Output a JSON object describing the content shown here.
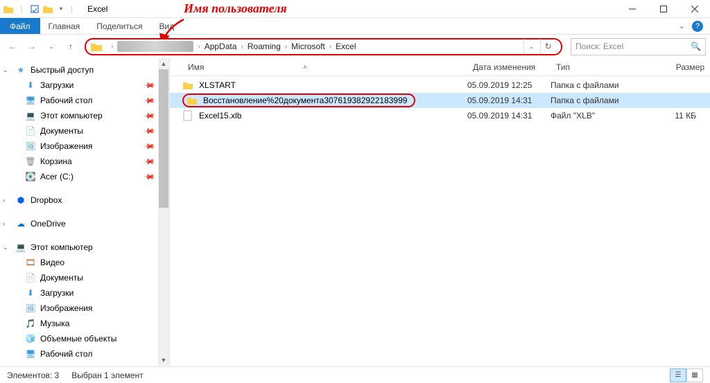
{
  "annotation": {
    "label": "Имя пользователя"
  },
  "title": "Excel",
  "ribbon": {
    "file": "Файл",
    "home": "Главная",
    "share": "Поделиться",
    "view": "Вид"
  },
  "nav": {
    "breadcrumb": [
      "AppData",
      "Roaming",
      "Microsoft",
      "Excel"
    ],
    "search_placeholder": "Поиск: Excel"
  },
  "sidebar": {
    "quick_access": "Быстрый доступ",
    "downloads": "Загрузки",
    "desktop": "Рабочий стол",
    "this_pc": "Этот компьютер",
    "documents": "Документы",
    "pictures": "Изображения",
    "recycle": "Корзина",
    "acer": "Acer (C:)",
    "dropbox": "Dropbox",
    "onedrive": "OneDrive",
    "this_pc2": "Этот компьютер",
    "video": "Видео",
    "documents2": "Документы",
    "downloads2": "Загрузки",
    "pictures2": "Изображения",
    "music": "Музыка",
    "objects3d": "Объемные объекты",
    "desktop2": "Рабочий стол"
  },
  "columns": {
    "name": "Имя",
    "date": "Дата изменения",
    "type": "Тип",
    "size": "Размер"
  },
  "files": [
    {
      "name": "XLSTART",
      "date": "05.09.2019 12:25",
      "type": "Папка с файлами",
      "size": "",
      "kind": "folder"
    },
    {
      "name": "Восстановление%20документа307619382922183999",
      "date": "05.09.2019 14:31",
      "type": "Папка с файлами",
      "size": "",
      "kind": "folder",
      "selected": true,
      "highlighted": true
    },
    {
      "name": "Excel15.xlb",
      "date": "05.09.2019 14:31",
      "type": "Файл \"XLB\"",
      "size": "11 КБ",
      "kind": "file"
    }
  ],
  "status": {
    "elements": "Элементов: 3",
    "selected": "Выбран 1 элемент"
  }
}
